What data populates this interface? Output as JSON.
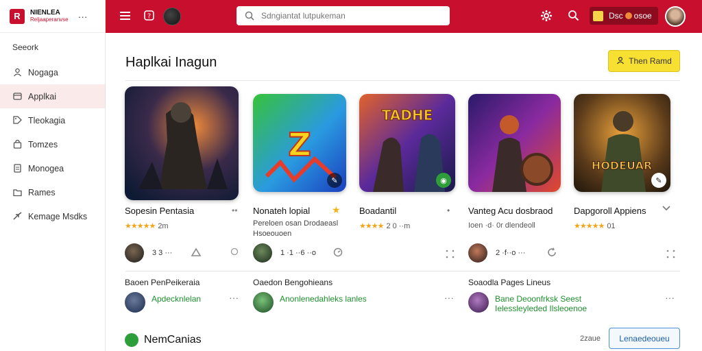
{
  "brand": {
    "name": "NIENLEA",
    "subtitle": "Reljaaperanvse",
    "more": "···",
    "logo_letter": "R"
  },
  "sidebar": {
    "section": "Seeork",
    "items": [
      {
        "label": "Nogaga",
        "icon": "person-icon",
        "active": false
      },
      {
        "label": "Applkai",
        "icon": "card-icon",
        "active": true
      },
      {
        "label": "Tleokagia",
        "icon": "tag-icon",
        "active": false
      },
      {
        "label": "Tomzes",
        "icon": "bag-icon",
        "active": false
      },
      {
        "label": "Monogea",
        "icon": "doc-icon",
        "active": false
      },
      {
        "label": "Rames",
        "icon": "folder-icon",
        "active": false
      },
      {
        "label": "Kemage Msdks",
        "icon": "arrow-icon",
        "active": false
      }
    ]
  },
  "topbar": {
    "search_placeholder": "Sdngiantat lutpukeman",
    "credits_text": "Dsc",
    "credits_value": "osoe"
  },
  "main": {
    "title": "Haplkai Inagun",
    "primary_button": "Then Ramd",
    "cards": [
      {
        "name": "Sopesin Pentasia",
        "stars": "★★★★★",
        "meta": "2m",
        "count": "3 3 ···",
        "color_a": "#1b2a4a",
        "color_b": "#e0722b",
        "badge": ""
      },
      {
        "name": "Nonateh lopial",
        "meta2": "Pereloen osan Drodaeasl Hsoeouoen",
        "count": "1 ·1 ··6 ··o",
        "color_a": "#2db83a",
        "color_b": "#1f6fd4",
        "badge": "✎"
      },
      {
        "name": "Boadantil",
        "stars": "★★★★",
        "meta": "2 0 ··m",
        "count": "",
        "color_a": "#2a1b6b",
        "color_b": "#e25b2a",
        "badge": "◉"
      },
      {
        "name": "Vanteg Acu dosbraod",
        "meta": "Ioen ·d· 0r dlendeoll",
        "count": "2 ·f··o ···",
        "color_a": "#3a1a7a",
        "color_b": "#ea4a2a",
        "badge": ""
      },
      {
        "name": "Dapgoroll Appiens",
        "stars": "★★★★★",
        "meta": "01",
        "count": "",
        "color_a": "#3a2a14",
        "color_b": "#e0a030",
        "badge": "✎"
      }
    ],
    "recommended": [
      {
        "title": "Baoen PenPeikeraia",
        "link": "Apdecknlelan",
        "avatar_color": "#2a3a5a"
      },
      {
        "title": "Oaedon Bengohieans",
        "link": "Anonlenedahleks lanles",
        "avatar_color": "#2e8a3a"
      },
      {
        "title": "Soaodla Pages Lineus",
        "link": "Bane Deoonfrksk Seest Ielessleyleded Ilsleoenoe",
        "avatar_color": "#6a2a8a"
      }
    ],
    "new_section_title": "NemCanias",
    "new_count": "2zaue",
    "outline_button": "Lenaedeoueu"
  }
}
